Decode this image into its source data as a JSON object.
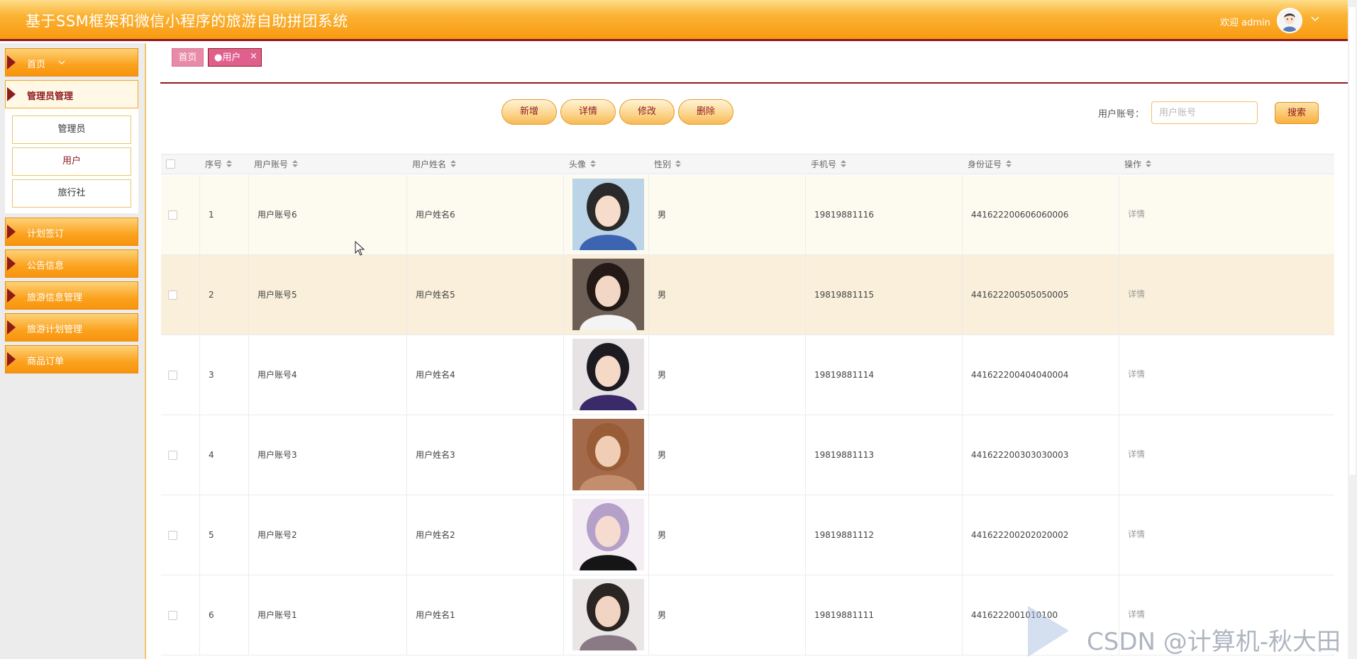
{
  "header": {
    "title": "基于SSM框架和微信小程序的旅游自助拼团系统",
    "welcome": "欢迎 admin"
  },
  "sidebar": {
    "home": "首页",
    "admin_group": "管理员管理",
    "sub_items": [
      {
        "label": "管理员"
      },
      {
        "label": "用户"
      },
      {
        "label": "旅行社"
      }
    ],
    "items": [
      {
        "label": "计划签订"
      },
      {
        "label": "公告信息"
      },
      {
        "label": "旅游信息管理"
      },
      {
        "label": "旅游计划管理"
      },
      {
        "label": "商品订单"
      }
    ]
  },
  "tabs": {
    "home": "首页",
    "user": "●用户",
    "close": "×"
  },
  "toolbar": {
    "add": "新增",
    "detail": "详情",
    "edit": "修改",
    "delete": "删除",
    "search_label": "用户账号：",
    "search_placeholder": "用户账号",
    "search_button": "搜索"
  },
  "table": {
    "columns": [
      "序号",
      "用户账号",
      "用户姓名",
      "头像",
      "性别",
      "手机号",
      "身份证号",
      "操作"
    ],
    "rows": [
      {
        "no": "1",
        "account": "用户账号6",
        "name": "用户姓名6",
        "gender": "男",
        "phone": "19819881116",
        "idcard": "441622200606060006",
        "op": "详情"
      },
      {
        "no": "2",
        "account": "用户账号5",
        "name": "用户姓名5",
        "gender": "男",
        "phone": "19819881115",
        "idcard": "441622200505050005",
        "op": "详情"
      },
      {
        "no": "3",
        "account": "用户账号4",
        "name": "用户姓名4",
        "gender": "男",
        "phone": "19819881114",
        "idcard": "441622200404040004",
        "op": "详情"
      },
      {
        "no": "4",
        "account": "用户账号3",
        "name": "用户姓名3",
        "gender": "男",
        "phone": "19819881113",
        "idcard": "441622200303030003",
        "op": "详情"
      },
      {
        "no": "5",
        "account": "用户账号2",
        "name": "用户姓名2",
        "gender": "男",
        "phone": "19819881112",
        "idcard": "441622200202020002",
        "op": "详情"
      },
      {
        "no": "6",
        "account": "用户账号1",
        "name": "用户姓名1",
        "gender": "男",
        "phone": "19819881111",
        "idcard": "4416222001010100",
        "op": "详情"
      }
    ]
  },
  "watermark": "CSDN @计算机-秋大田",
  "colors": {
    "brand_orange": "#f99a12",
    "brand_maroon": "#8d1a1f",
    "tab_pink": "#e0608d"
  }
}
